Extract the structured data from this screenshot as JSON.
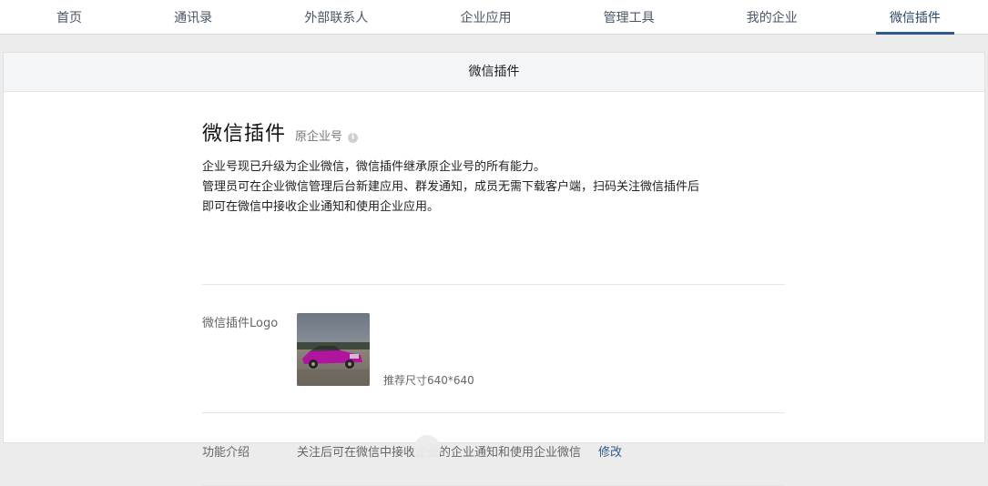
{
  "nav": {
    "items": [
      {
        "label": "首页"
      },
      {
        "label": "通讯录"
      },
      {
        "label": "外部联系人"
      },
      {
        "label": "企业应用"
      },
      {
        "label": "管理工具"
      },
      {
        "label": "我的企业"
      },
      {
        "label": "微信插件"
      }
    ],
    "active_index": 6
  },
  "panel": {
    "header": "微信插件",
    "title": "微信插件",
    "subtitle": "原企业号",
    "info_glyph": "i",
    "desc": [
      "企业号现已升级为企业微信，微信插件继承原企业号的所有能力。",
      "管理员可在企业微信管理后台新建应用、群发通知，成员无需下载客户端，扫码关注微信插件后",
      "即可在微信中接收企业通知和使用企业应用。"
    ],
    "logo": {
      "label": "微信插件Logo",
      "hint": "推荐尺寸640*640"
    },
    "function": {
      "label": "功能介绍",
      "text": "关注后可在微信中接收企业的企业通知和使用企业微信",
      "edit": "修改"
    }
  },
  "colors": {
    "accent": "#2f5a8c",
    "nav_text": "#4a5665"
  },
  "icons": {
    "info": "info-icon"
  }
}
